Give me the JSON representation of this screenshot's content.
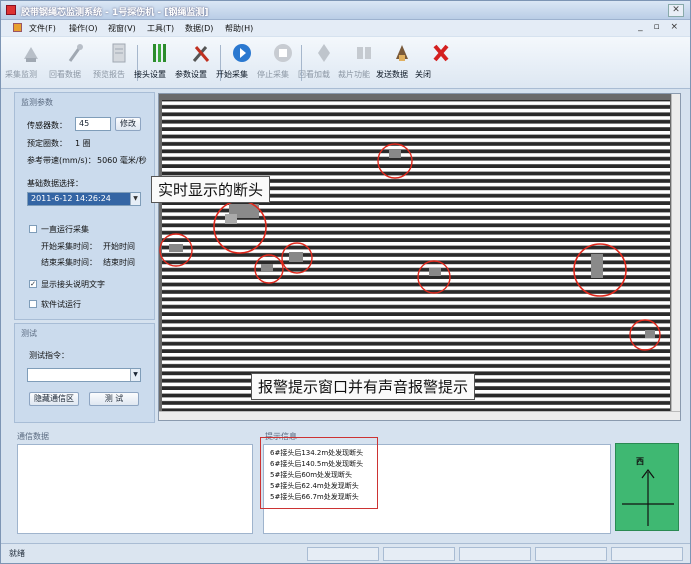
{
  "window": {
    "title": "胶带钢绳芯监测系统 - 1号探伤机 - [钢绳监测]"
  },
  "menu": {
    "items": [
      "文件(F)",
      "操作(O)",
      "视窗(V)",
      "工具(T)",
      "数据(D)",
      "帮助(H)"
    ],
    "mdi_controls": "_ ▫ ×"
  },
  "toolbar": {
    "buttons": [
      {
        "label": "采集监测",
        "state": "disabled",
        "icon": "collect-monitor-icon"
      },
      {
        "label": "回看数据",
        "state": "disabled",
        "icon": "review-data-icon"
      },
      {
        "label": "预览报告",
        "state": "disabled",
        "icon": "preview-report-icon"
      },
      {
        "label": "接头设置",
        "state": "enabled",
        "icon": "joint-settings-icon"
      },
      {
        "label": "参数设置",
        "state": "enabled",
        "icon": "param-settings-icon"
      },
      {
        "label": "开始采集",
        "state": "enabled",
        "icon": "start-collect-icon"
      },
      {
        "label": "停止采集",
        "state": "disabled",
        "icon": "stop-collect-icon"
      },
      {
        "label": "回看加载",
        "state": "disabled",
        "icon": "review-load-icon"
      },
      {
        "label": "裁片功能",
        "state": "disabled",
        "icon": "cut-function-icon"
      },
      {
        "label": "发送数据",
        "state": "enabled",
        "icon": "send-data-icon"
      },
      {
        "label": "关闭",
        "state": "enabled",
        "icon": "close-icon"
      }
    ]
  },
  "monitor_params": {
    "title": "监测参数",
    "sensor_count_label": "传感器数：",
    "sensor_count_value": "45",
    "modify_button": "修改",
    "preset_turns_label": "预定圈数：",
    "preset_turns_value": "1 圈",
    "ref_speed_label": "参考带速(mm/s)：",
    "ref_speed_value": "5060 毫米/秒",
    "base_data_label": "基础数据选择：",
    "base_data_value": "2011-6-12 14:26:24",
    "continuous_label": "一直运行采集",
    "continuous_checked": false,
    "start_time_label": "开始采集时间：",
    "start_time_value": "开始时间",
    "end_time_label": "结束采集时间：",
    "end_time_value": "结束时间",
    "show_joint_label": "显示接头说明文字",
    "show_joint_checked": true,
    "software_test_label": "软件试运行",
    "software_test_checked": false
  },
  "test_panel": {
    "title": "测试",
    "cmd_label": "测试指令：",
    "cmd_value": "",
    "hide_button": "隐藏通信区",
    "test_button": "测 试"
  },
  "annotations": {
    "realtime_break": "实时显示的断头",
    "alarm_hint": "报警提示窗口并有声音报警提示"
  },
  "comm_data": {
    "title": "通信数据"
  },
  "alarm": {
    "title": "提示信息",
    "lines": [
      "6#接头后134.2m处发现断头",
      "6#接头后140.5m处发现断头",
      "5#接头后60m处发现断头",
      "5#接头后62.4m处发现断头",
      "5#接头后66.7m处发现断头"
    ]
  },
  "direction": {
    "label": "西",
    "color": "#3fb872"
  },
  "status": {
    "text": "就绪"
  },
  "colors": {
    "highlight_circle": "#e0281c",
    "annotation_box": "#cc3333"
  }
}
